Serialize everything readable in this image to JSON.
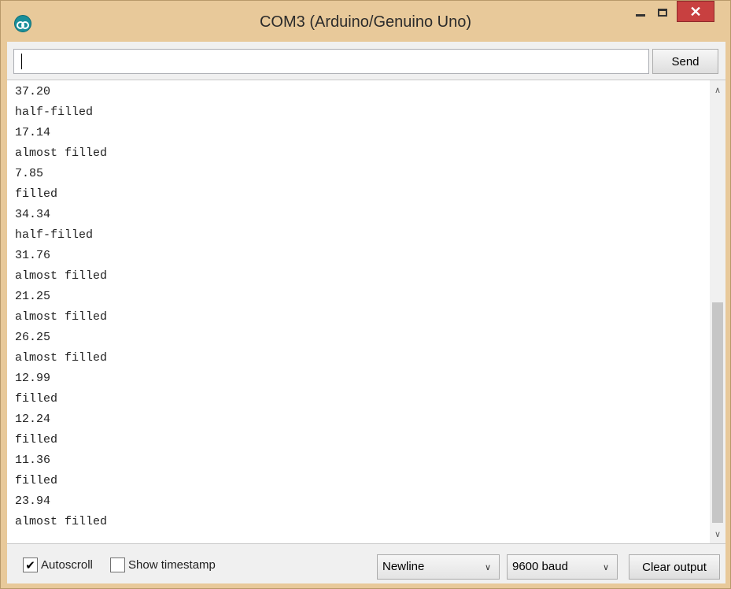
{
  "window": {
    "title": "COM3 (Arduino/Genuino Uno)",
    "icon": "arduino-icon",
    "controls": {
      "minimize": "minimize-icon",
      "maximize": "maximize-icon",
      "close_glyph": "✕"
    }
  },
  "send_bar": {
    "input_value": "",
    "send_label": "Send"
  },
  "output": {
    "lines": [
      "37.20",
      "half-filled",
      "17.14",
      "almost filled",
      "7.85",
      "filled",
      "34.34",
      "half-filled",
      "31.76",
      "almost filled",
      "21.25",
      "almost filled",
      "26.25",
      "almost filled",
      "12.99",
      "filled",
      "12.24",
      "filled",
      "11.36",
      "filled",
      "23.94",
      "almost filled"
    ],
    "scroll_up_glyph": "∧",
    "scroll_down_glyph": "∨"
  },
  "footer": {
    "autoscroll_label": "Autoscroll",
    "autoscroll_checked": true,
    "check_glyph": "✔",
    "timestamp_label": "Show timestamp",
    "timestamp_checked": false,
    "line_ending": "Newline",
    "baud_rate": "9600 baud",
    "dropdown_glyph": "∨",
    "clear_label": "Clear output"
  },
  "colors": {
    "frame": "#e8c99a",
    "close_button": "#c84040",
    "client_bg": "#f0f0f0"
  }
}
